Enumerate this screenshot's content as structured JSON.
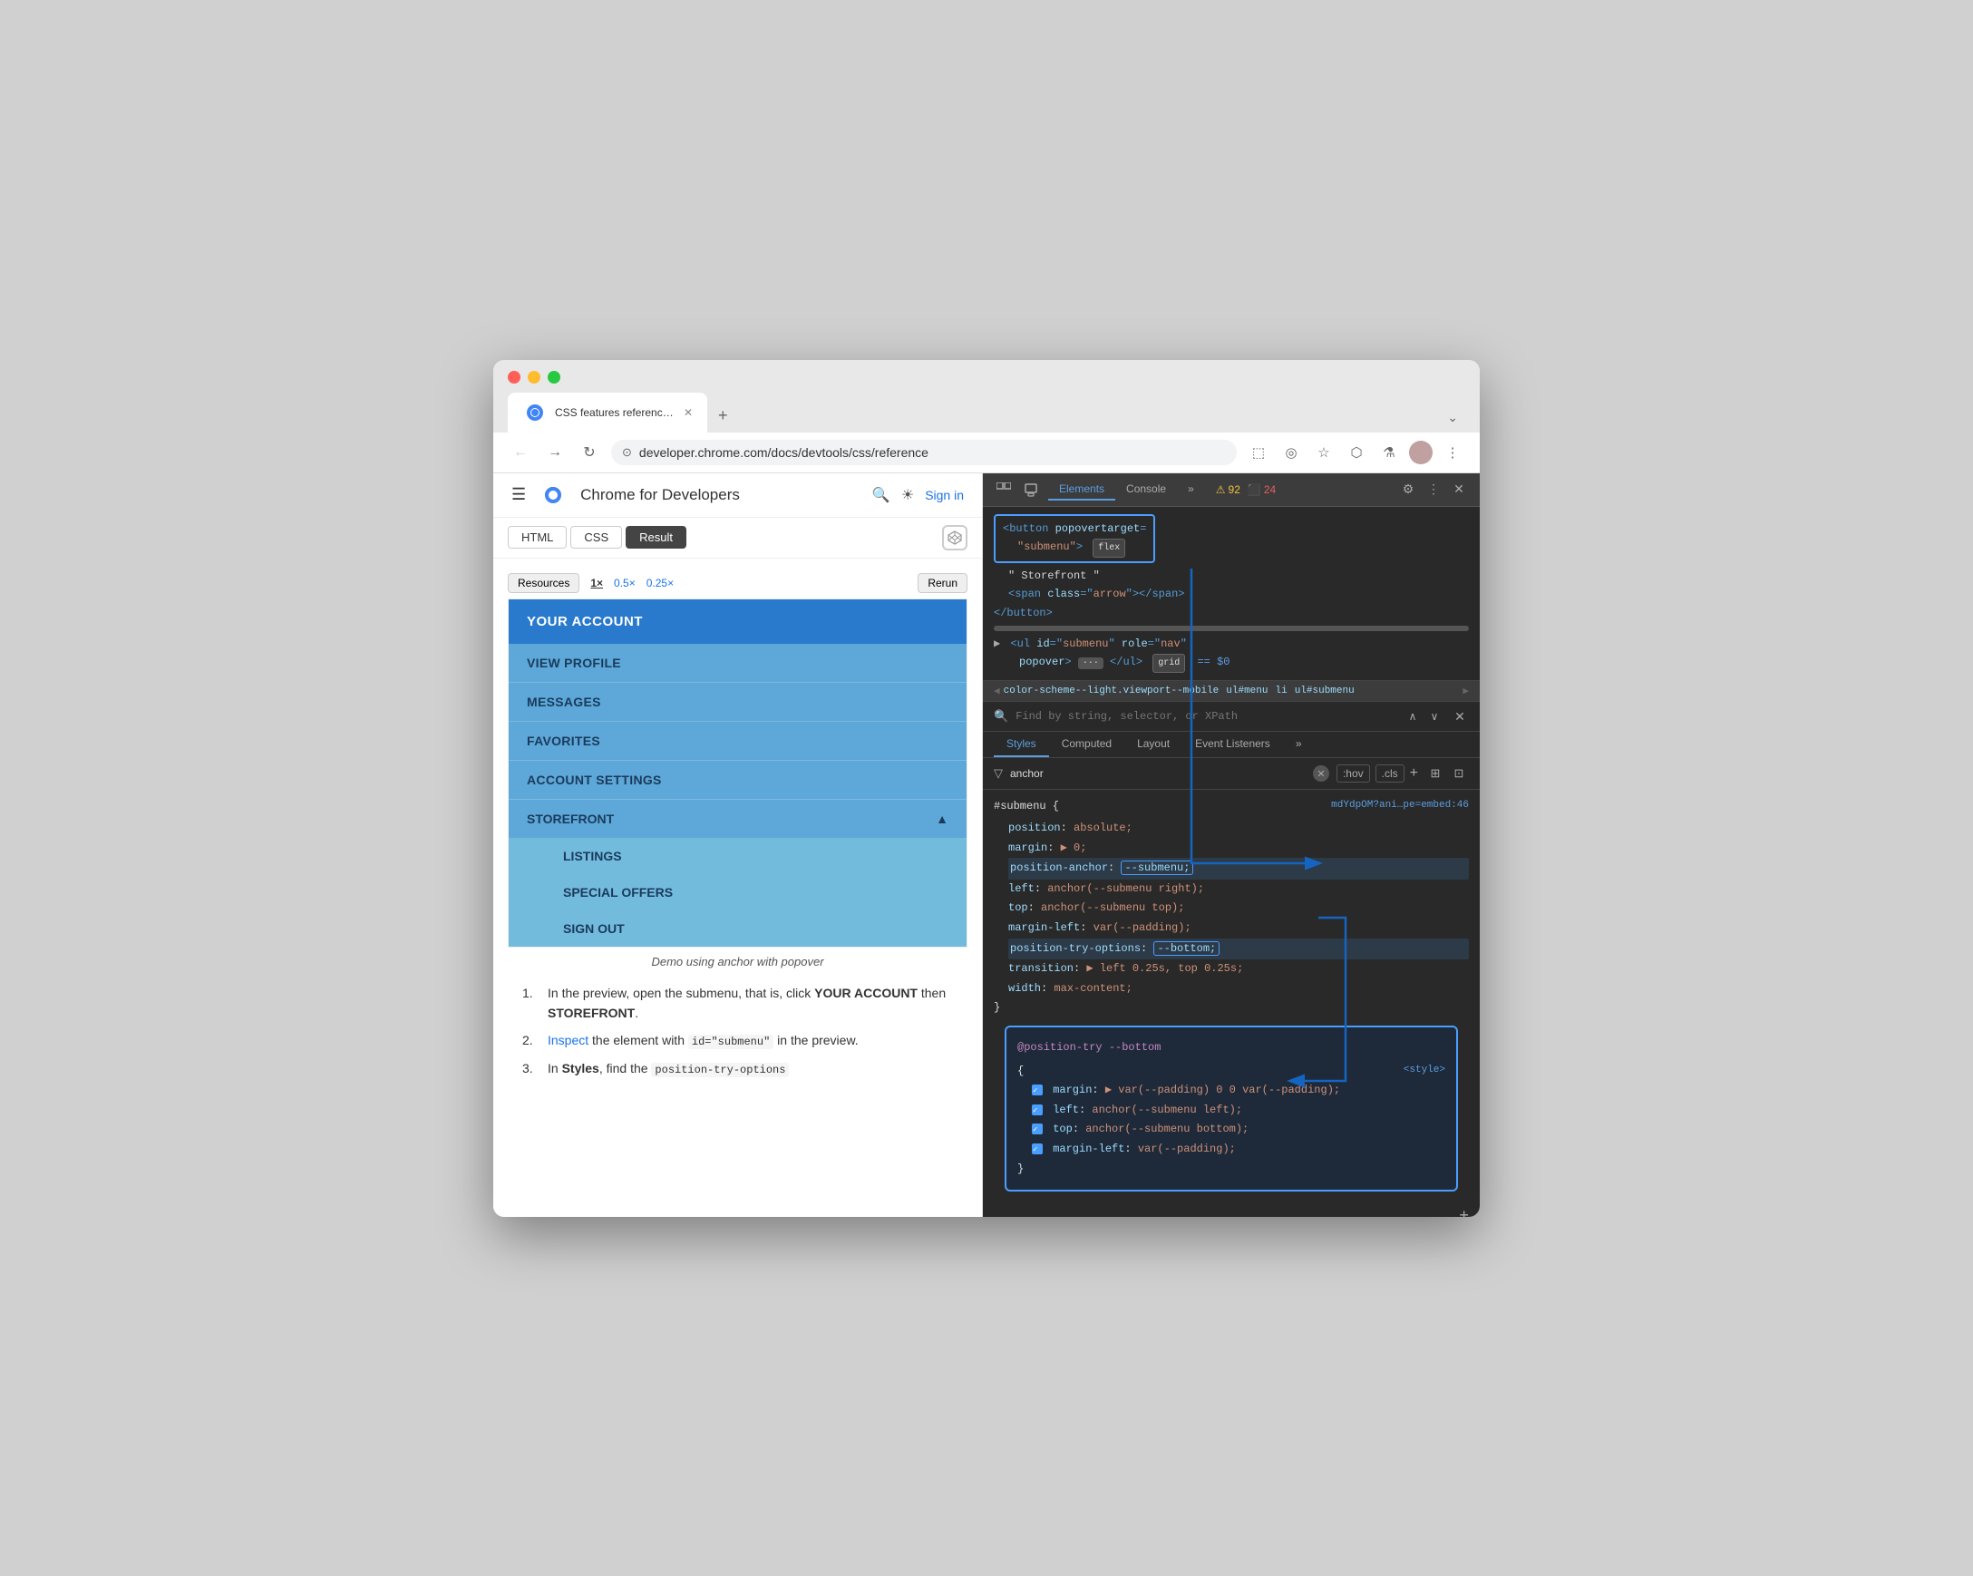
{
  "browser": {
    "tab": {
      "title": "CSS features reference | Chr",
      "favicon_color": "#4285f4"
    },
    "url": "developer.chrome.com/docs/devtools/css/reference",
    "new_tab_label": "+",
    "more_label": "⌄"
  },
  "webpage": {
    "site_title": "Chrome for Developers",
    "sign_in": "Sign in",
    "code_tabs": [
      "HTML",
      "CSS",
      "Result"
    ],
    "active_tab": "Result",
    "menu": {
      "header": "YOUR ACCOUNT",
      "items": [
        "VIEW PROFILE",
        "MESSAGES",
        "FAVORITES",
        "ACCOUNT SETTINGS",
        "STOREFRONT"
      ],
      "storefront_arrow": "▲",
      "submenu_items": [
        "LISTINGS",
        "SPECIAL OFFERS",
        "SIGN OUT"
      ]
    },
    "demo_controls": {
      "resources_label": "Resources",
      "zoom_options": [
        "1×",
        "0.5×",
        "0.25×"
      ],
      "rerun_label": "Rerun"
    },
    "demo_description": "Demo using anchor with  popover",
    "steps": [
      {
        "num": "1.",
        "text": "In the preview, open the submenu, that is, click ",
        "bold_parts": [
          "YOUR ACCOUNT",
          "STOREFRONT"
        ],
        "suffix": "."
      },
      {
        "num": "2.",
        "text_parts": [
          "",
          "Inspect",
          " the element with ",
          "id=\"submenu\"",
          " in the\npreview."
        ],
        "link": "Inspect",
        "code": "id=\"submenu\""
      },
      {
        "num": "3.",
        "text": "In ",
        "bold": "Styles",
        "suffix": ", find the ",
        "code": "position-try-options"
      }
    ]
  },
  "devtools": {
    "panels": [
      "Elements",
      "Console",
      "»"
    ],
    "active_panel": "Elements",
    "warnings_count": "92",
    "errors_count": "24",
    "html_tree": {
      "line1": "<button popovertarget=",
      "line2": "\"submenu\">",
      "flex_badge": "flex",
      "line3": "\" Storefront \"",
      "line4": "<span class=\"arrow\"></span>",
      "line5": "</button>",
      "line6_tri": "▶",
      "line6": "<ul id=\"submenu\" role=\"nav\"",
      "line7": "popover>",
      "ellipsis": "···",
      "line7b": "</ul>",
      "grid_badge": "grid",
      "dollar": "== $0"
    },
    "breadcrumb": {
      "items": [
        "color-scheme--light.viewport--mobile",
        "ul#menu",
        "li",
        "ul#submenu"
      ]
    },
    "find_placeholder": "Find by string, selector, or XPath",
    "styles_tabs": [
      "Styles",
      "Computed",
      "Layout",
      "Event Listeners",
      "»"
    ],
    "active_styles_tab": "Styles",
    "filter_placeholder": "anchor",
    "pseudo_states": [
      ":hov",
      ".cls"
    ],
    "submenu_rule": {
      "selector": "#submenu {",
      "file_ref": "mdYdpOM?ani…pe=embed:46",
      "properties": [
        {
          "name": "position",
          "colon": ":",
          "value": "absolute;"
        },
        {
          "name": "margin",
          "colon": ":",
          "value": "▶ 0;"
        },
        {
          "name": "position-anchor",
          "colon": ":",
          "value": "--submenu;",
          "highlighted": true
        },
        {
          "name": "left",
          "colon": ":",
          "value": "anchor(--submenu right);"
        },
        {
          "name": "top",
          "colon": ":",
          "value": "anchor(--submenu top);"
        },
        {
          "name": "margin-left",
          "colon": ":",
          "value": "var(--padding);"
        },
        {
          "name": "position-try-options",
          "colon": ":",
          "value": "--bottom;",
          "highlighted": true
        },
        {
          "name": "transition",
          "colon": ":",
          "value": "▶ left 0.25s, top 0.25s;"
        },
        {
          "name": "width",
          "colon": ":",
          "value": "max-content;"
        }
      ]
    },
    "position_try_block": {
      "selector": "@position-try --bottom",
      "style_tag": "<style>",
      "properties": [
        {
          "name": "margin",
          "colon": ":",
          "value": "▶ var(--padding) 0 0 var(--padding);"
        },
        {
          "name": "left",
          "colon": ":",
          "value": "anchor(--submenu left);"
        },
        {
          "name": "top",
          "colon": ":",
          "value": "anchor(--submenu bottom);"
        },
        {
          "name": "margin-left",
          "colon": ":",
          "value": "var(--padding);"
        }
      ],
      "close_brace": "}"
    }
  }
}
